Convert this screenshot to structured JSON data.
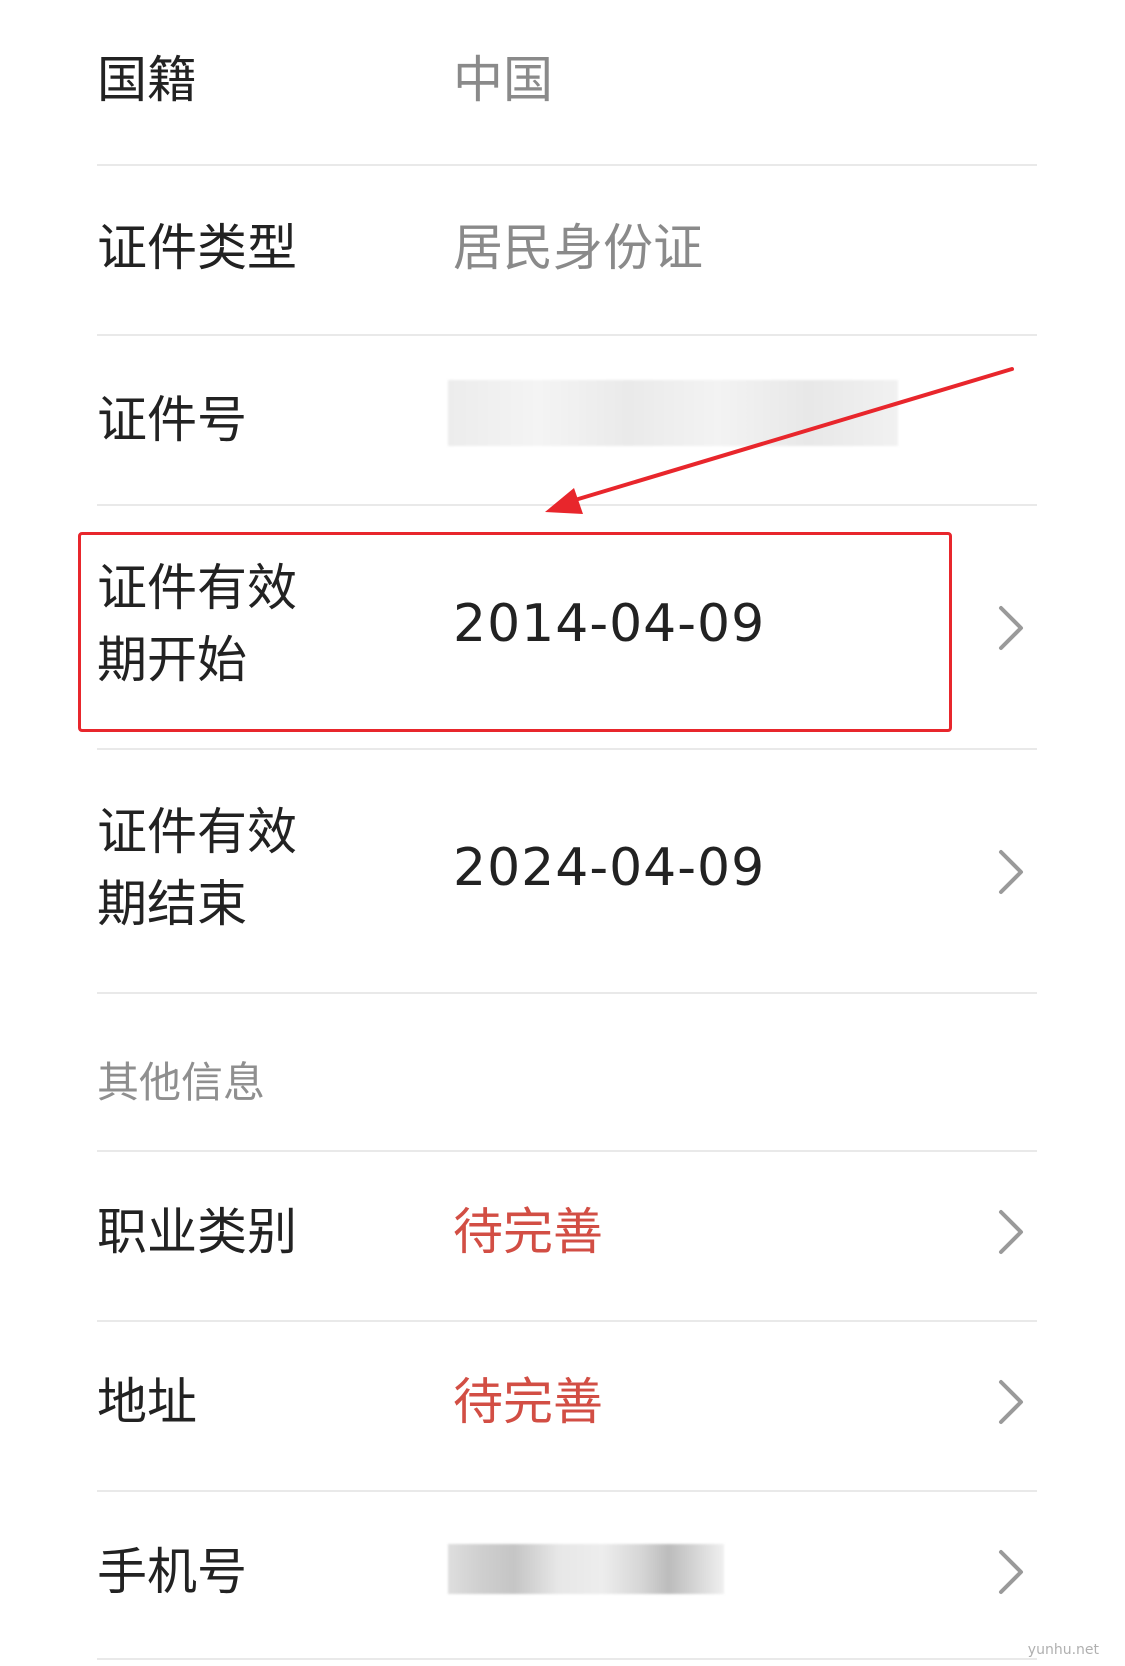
{
  "identity": {
    "nationality": {
      "label": "国籍",
      "value": "中国"
    },
    "id_type": {
      "label": "证件类型",
      "value": "居民身份证"
    },
    "id_number": {
      "label": "证件号",
      "value": ""
    },
    "valid_start": {
      "label_line1": "证件有效",
      "label_line2": "期开始",
      "value": "2014-04-09"
    },
    "valid_end": {
      "label_line1": "证件有效",
      "label_line2": "期结束",
      "value": "2024-04-09"
    }
  },
  "other_info": {
    "section_title": "其他信息",
    "occupation": {
      "label": "职业类别",
      "value": "待完善"
    },
    "address": {
      "label": "地址",
      "value": "待完善"
    },
    "phone": {
      "label": "手机号",
      "value": ""
    }
  },
  "watermark": "yunhu.net",
  "colors": {
    "accent_red": "#e8262c",
    "todo_text": "#d24e44",
    "grey_text": "#8a8a8a",
    "divider": "#e9e9e9"
  },
  "icons": {
    "row_chevron": "chevron-right-icon"
  }
}
